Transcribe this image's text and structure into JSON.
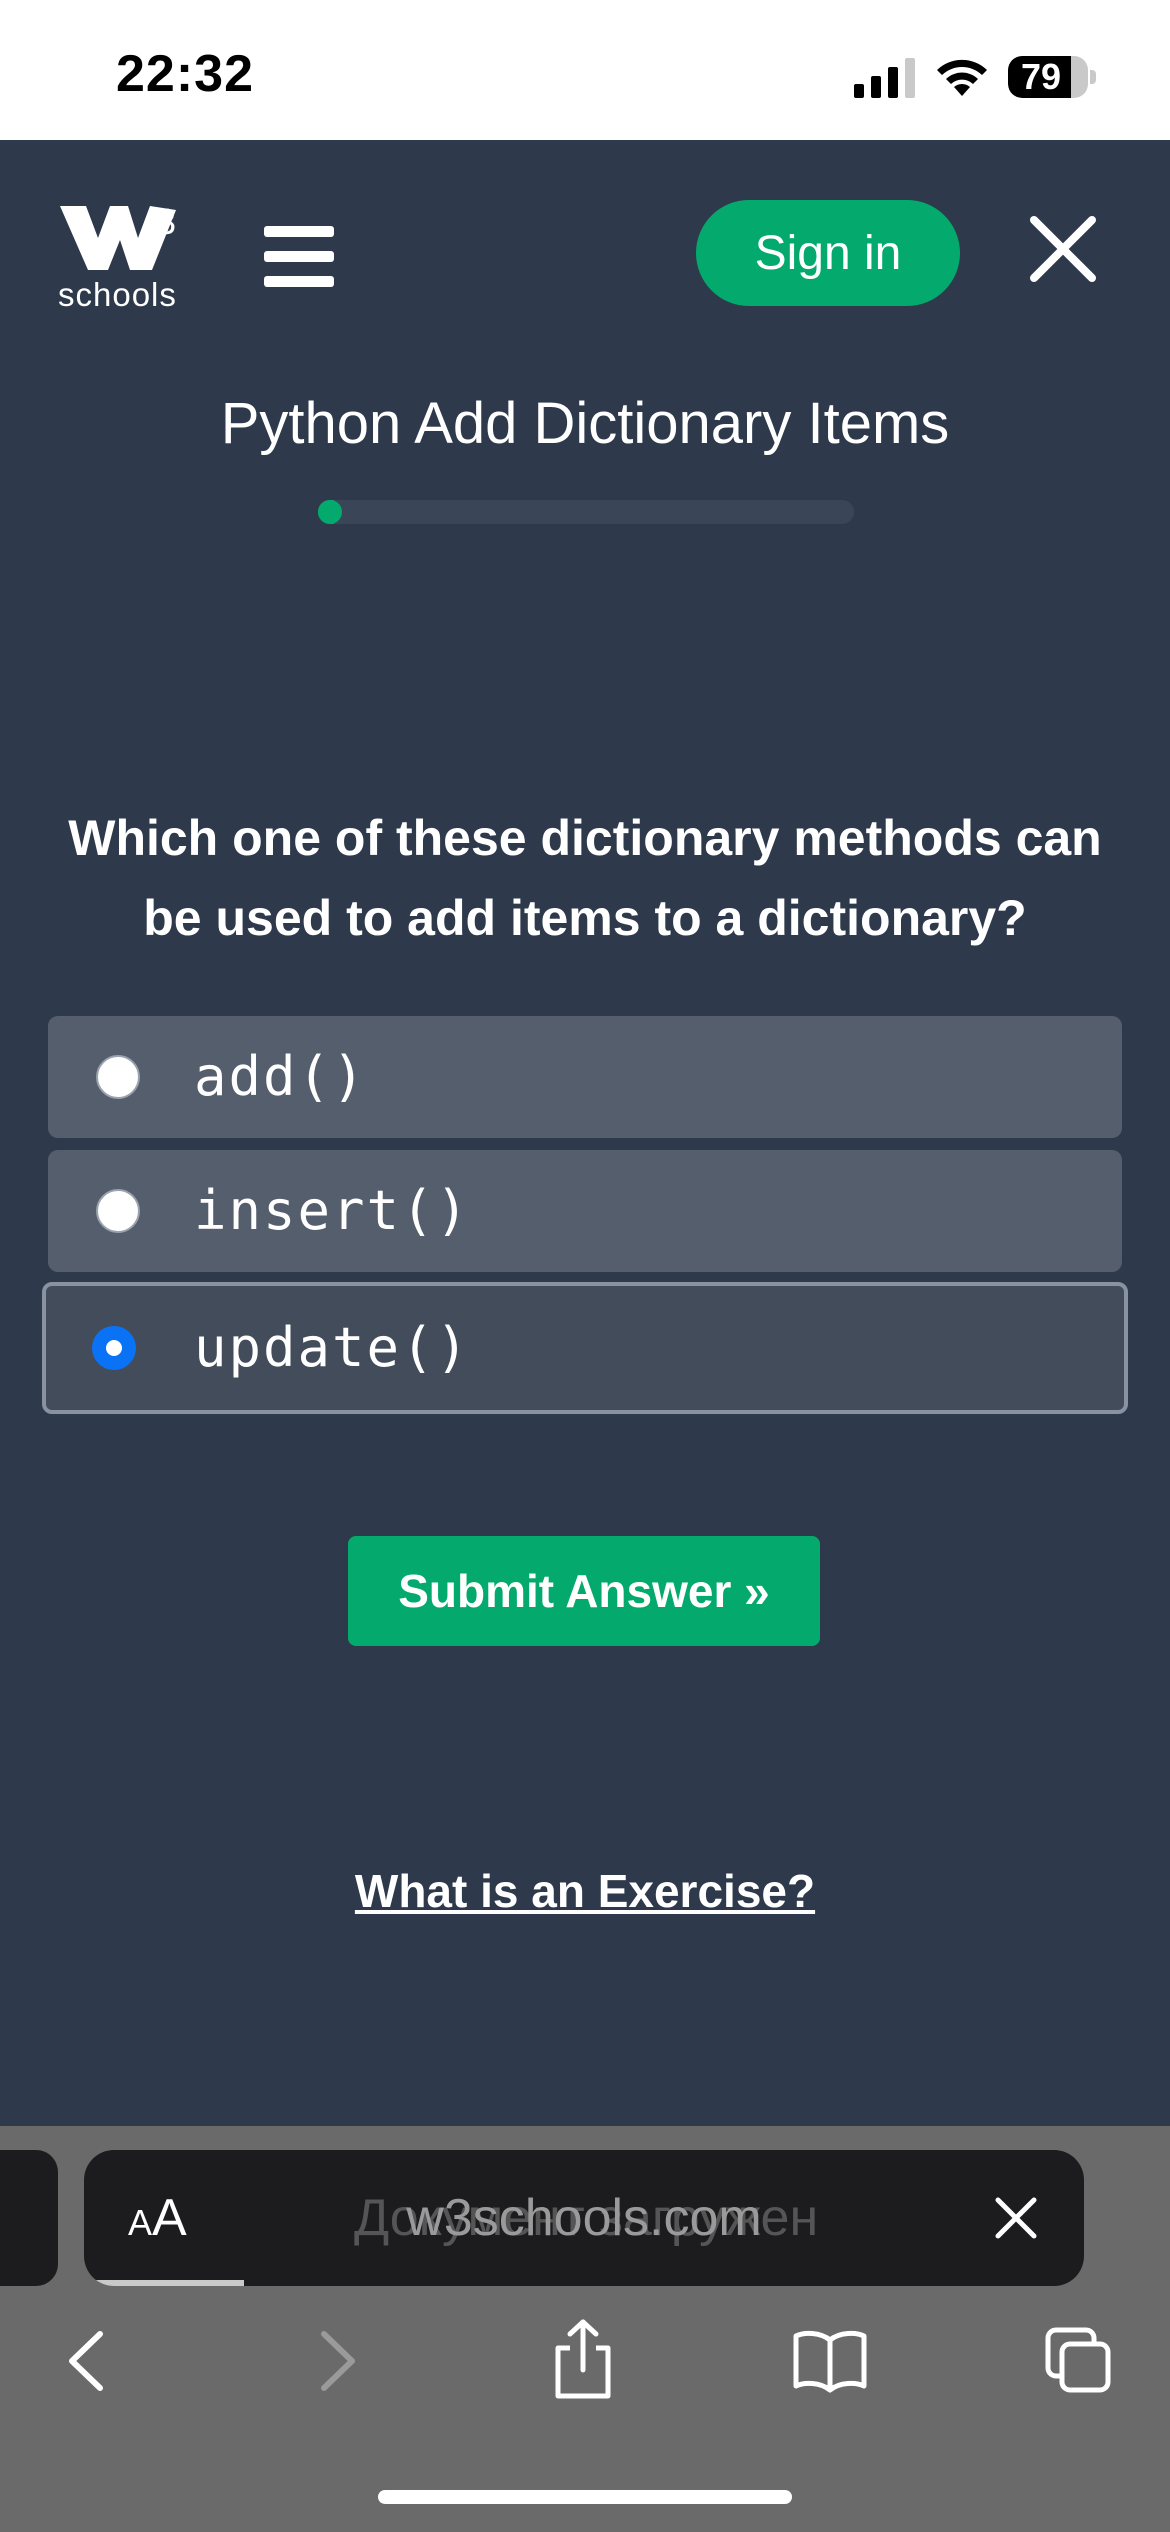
{
  "status_bar": {
    "time": "22:32",
    "battery_percent": "79",
    "battery_level": 0.79
  },
  "header": {
    "logo_superscript": "3",
    "logo_text": "schools",
    "sign_in_label": "Sign in",
    "icons": [
      "w3schools-logo",
      "hamburger-menu-icon",
      "close-icon"
    ]
  },
  "exercise": {
    "title": "Python Add Dictionary Items",
    "progress": 0.03,
    "question": "Which one of these dictionary methods can be used to add items to a dictionary?",
    "options": [
      {
        "label": "add()",
        "selected": false
      },
      {
        "label": "insert()",
        "selected": false
      },
      {
        "label": "update()",
        "selected": true
      }
    ],
    "submit_label": "Submit Answer »",
    "help_link": "What is an Exercise?"
  },
  "browser": {
    "text_size_small": "A",
    "text_size_big": "A",
    "ghost_text": "Документ загружен",
    "url": "w3schools.com",
    "load_progress": 0.16,
    "icons": [
      "back-icon",
      "forward-icon",
      "share-icon",
      "bookmarks-icon",
      "tabs-icon"
    ]
  },
  "colors": {
    "accent": "#04aa6d",
    "background": "#2e3a4b",
    "radio_selected": "#0a73f5"
  }
}
